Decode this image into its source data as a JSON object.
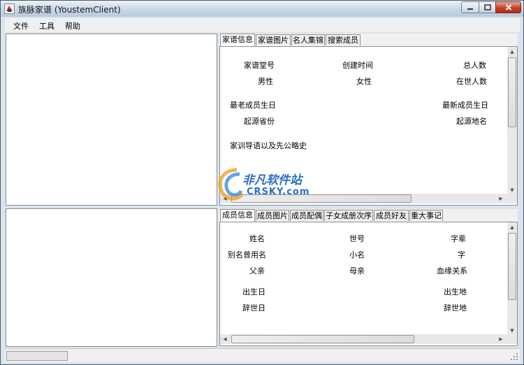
{
  "window": {
    "title": "族脉家谱 (YoustemClient)"
  },
  "menu": {
    "items": [
      "文件",
      "工具",
      "帮助"
    ]
  },
  "upper_panel": {
    "tabs": [
      "家谱信息",
      "家谱图片",
      "名人集锦",
      "搜索成员"
    ],
    "active_tab": "家谱信息",
    "fields": {
      "tang_hao": "家谱堂号",
      "created": "创建时间",
      "total": "总人数",
      "male": "男性",
      "female": "女性",
      "alive": "在世人数",
      "oldest_birthday": "最老成员生日",
      "newest_birthday": "最新成员生日",
      "origin_province": "起源省份",
      "origin_place": "起源地名",
      "motto": "家训导语以及先公略史"
    }
  },
  "lower_panel": {
    "tabs": [
      "成员信息",
      "成员图片",
      "成员配偶",
      "子女成册次序",
      "成员好友",
      "重大事记"
    ],
    "active_tab": "成员信息",
    "fields": {
      "name": "姓名",
      "generation": "世号",
      "zi_bei": "字辈",
      "alias": "别名曾用名",
      "nickname": "小名",
      "courtesy": "字",
      "father": "父亲",
      "mother": "母亲",
      "blood_relation": "血缘关系",
      "birth_date": "出生日",
      "birth_place": "出生地",
      "death_date": "辞世日",
      "death_place": "辞世地"
    }
  },
  "watermark": {
    "text": "非凡软件站",
    "sub": "CRSKY.com"
  },
  "colors": {
    "titlebar": "#c9d8e6",
    "close_button": "#c4432d",
    "watermark": "#2b6fc7"
  }
}
